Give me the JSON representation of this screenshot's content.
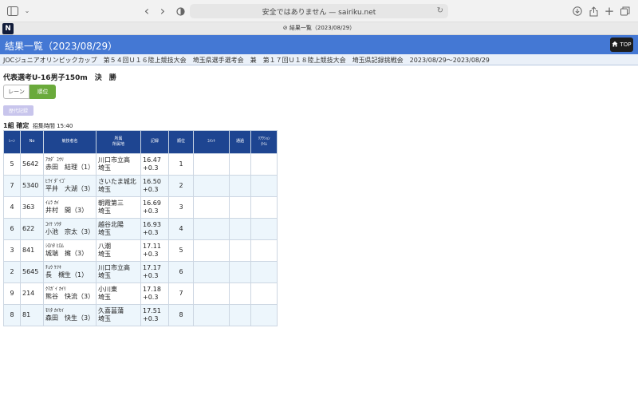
{
  "browser": {
    "address": "安全ではありません — sairiku.net",
    "tab_title": "結果一覧（2023/08/29）",
    "favicon_letter": "N"
  },
  "header": {
    "title": "結果一覧（2023/08/29）",
    "top_label": "TOP"
  },
  "competition": "JOCジュニアオリンピックカップ　第５４回Ｕ１６陸上競技大会　埼玉県選手選考会　兼　第１７回Ｕ１８陸上競技大会　埼玉県記録挑戦会　2023/08/29〜2023/08/29",
  "event_title": "代表選考U-16男子150m　決　勝",
  "segment": {
    "lane": "レーン",
    "rank": "順位"
  },
  "history_button": "歴代記録",
  "heat": {
    "label": "1組 確定",
    "call": "招集時間 15:40"
  },
  "table": {
    "headers": {
      "lane": "ﾚｰﾝ",
      "no": "No",
      "name": "競技者名",
      "team1": "所属",
      "team2": "所属地",
      "record": "記録",
      "rank": "順位",
      "comment": "ｺﾒﾝﾄ",
      "pass": "通過",
      "reaction1": "ﾘｱｸｼｮﾝ",
      "reaction2": "ﾀｲﾑ"
    },
    "rows": [
      {
        "lane": "5",
        "no": "5642",
        "kana": "ｱｶﾀﾞ ﾕｳﾘ",
        "name": "赤田　結理（1）",
        "team": "川口市立高",
        "pref": "埼玉",
        "time": "16.47",
        "wind": "+0.3",
        "rank": "1"
      },
      {
        "lane": "7",
        "no": "5340",
        "kana": "ﾋﾗｲ ﾀﾞｲｺﾞ",
        "name": "平井　大湖（3）",
        "team": "さいたま城北",
        "pref": "埼玉",
        "time": "16.50",
        "wind": "+0.3",
        "rank": "2"
      },
      {
        "lane": "4",
        "no": "363",
        "kana": "ｲﾑﾗ ｶｲ",
        "name": "井村　開（3）",
        "team": "朝霞第三",
        "pref": "埼玉",
        "time": "16.69",
        "wind": "+0.3",
        "rank": "3"
      },
      {
        "lane": "6",
        "no": "622",
        "kana": "ｺｲｹ ｿｳﾀ",
        "name": "小池　宗太（3）",
        "team": "越谷北陽",
        "pref": "埼玉",
        "time": "16.93",
        "wind": "+0.3",
        "rank": "4"
      },
      {
        "lane": "3",
        "no": "841",
        "kana": "ｼﾛﾊﾀ ﾋﾛﾑ",
        "name": "城端　擁（3）",
        "team": "八潮",
        "pref": "埼玉",
        "time": "17.11",
        "wind": "+0.3",
        "rank": "5"
      },
      {
        "lane": "2",
        "no": "5645",
        "kana": "ﾁｮｳ ｹﾂｷ",
        "name": "長　槻生（1）",
        "team": "川口市立高",
        "pref": "埼玉",
        "time": "17.17",
        "wind": "+0.3",
        "rank": "6"
      },
      {
        "lane": "9",
        "no": "214",
        "kana": "ｸﾏｶﾞｲ ｶｲﾘ",
        "name": "熊谷　快流（3）",
        "team": "小川東",
        "pref": "埼玉",
        "time": "17.18",
        "wind": "+0.3",
        "rank": "7"
      },
      {
        "lane": "8",
        "no": "81",
        "kana": "ﾓﾘﾀ ｶｲｾｲ",
        "name": "森田　快生（3）",
        "team": "久喜菖蒲",
        "pref": "埼玉",
        "time": "17.51",
        "wind": "+0.3",
        "rank": "8"
      }
    ]
  },
  "colors": {
    "header_bg": "#4478d4",
    "table_header_bg": "#1e4591",
    "rank_button": "#6aaa3b",
    "history_button": "#c8c5ec",
    "row_alt": "#edf6fc"
  },
  "icons": [
    "sidebar-icon",
    "chevron-down-icon",
    "back-icon",
    "forward-icon",
    "shield-icon",
    "reload-icon",
    "download-icon",
    "share-icon",
    "new-tab-icon",
    "tabs-overview-icon",
    "home-icon"
  ]
}
